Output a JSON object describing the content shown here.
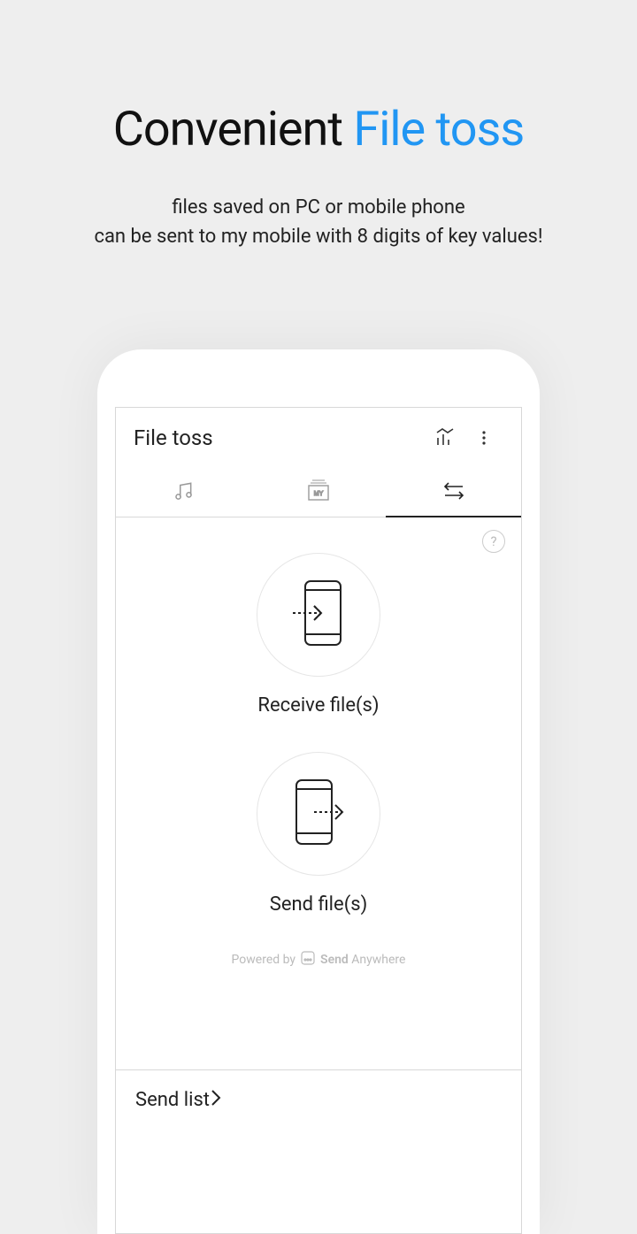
{
  "hero": {
    "title_black": "Convenient ",
    "title_blue": "File toss",
    "subtitle_line1": "files saved on PC or mobile phone",
    "subtitle_line2": "can be sent to my mobile with 8 digits of key values!"
  },
  "appbar": {
    "title": "File toss"
  },
  "tabs": {
    "my_label": "MY"
  },
  "help": {
    "label": "?"
  },
  "actions": {
    "receive": {
      "label": "Receive file(s)"
    },
    "send": {
      "label": "Send file(s)"
    }
  },
  "powered": {
    "prefix": "Powered by",
    "brand_bold": "Send",
    "brand_light": " Anywhere"
  },
  "send_list": {
    "label": "Send list"
  }
}
